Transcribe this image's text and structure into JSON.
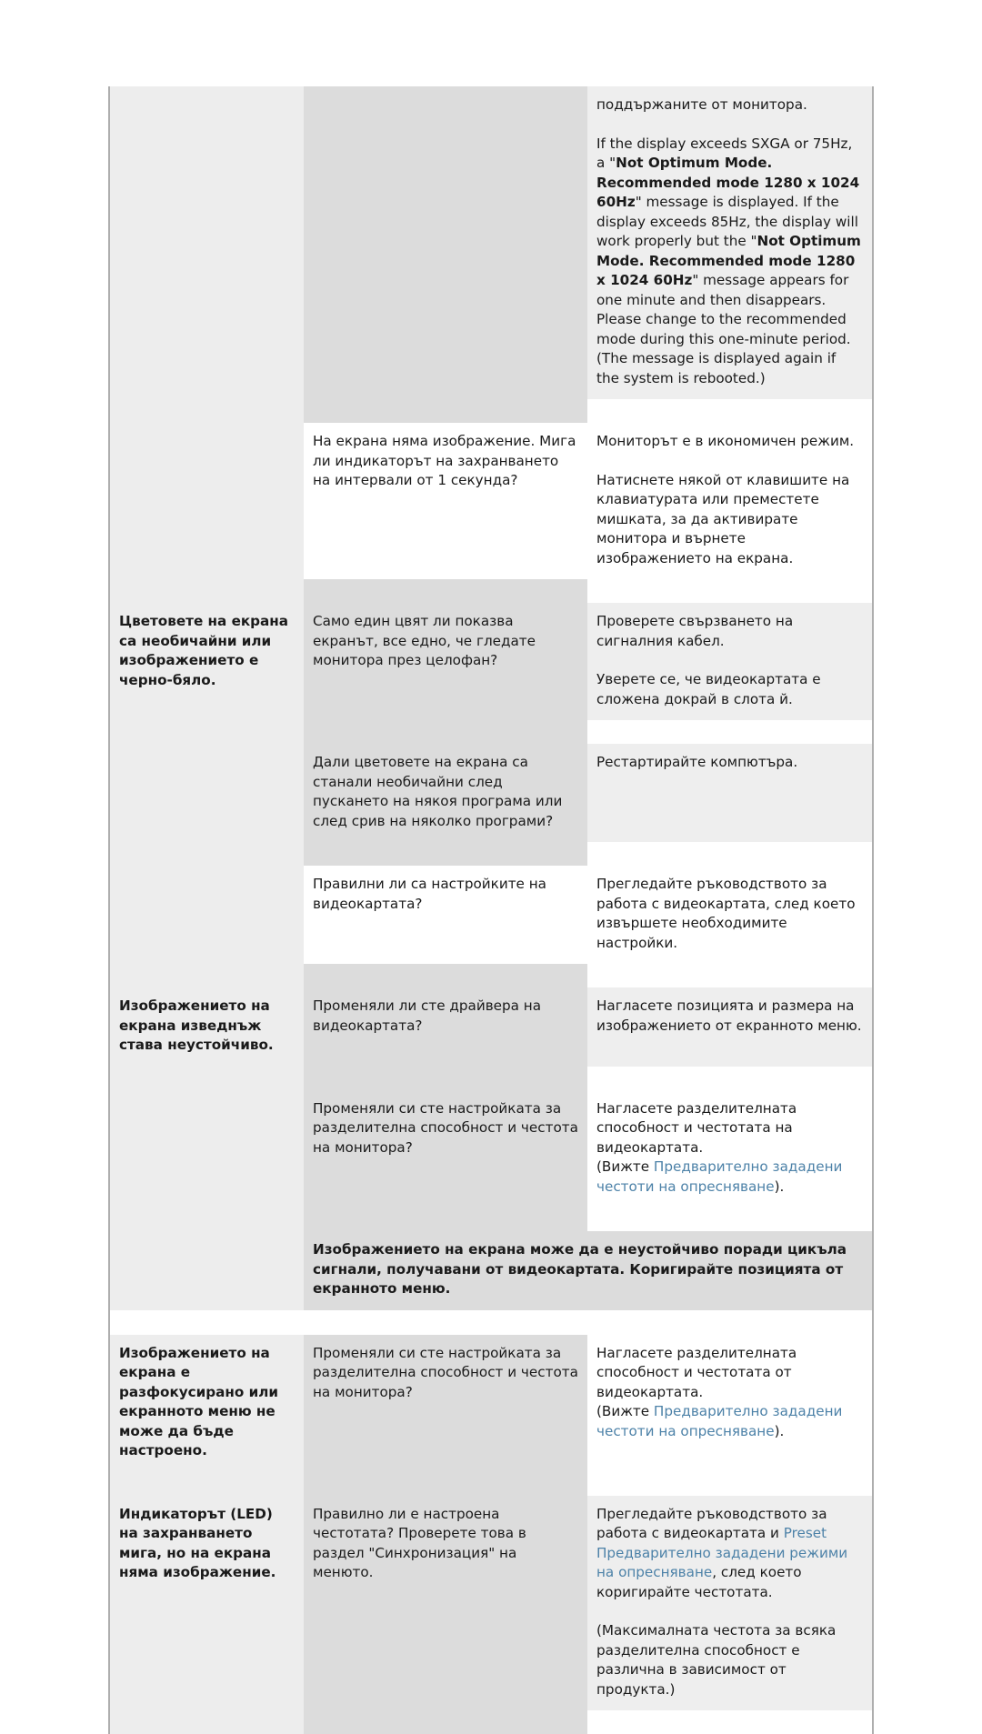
{
  "document": {
    "language": "bg",
    "kind": "monitor-troubleshooting-table",
    "link_color": "#4d82a8",
    "shade_color": "#dcdcdc",
    "category_color": "#ededed"
  },
  "rows": [
    {
      "id": "row-resolution-message",
      "category": "",
      "question": "",
      "answer_blocks": [
        {
          "type": "plain",
          "text": "поддържаните от монитора."
        },
        {
          "type": "spacer"
        },
        {
          "type": "rich",
          "segments": [
            {
              "text": "If the display exceeds SXGA or 75Hz, a \"",
              "bold": false
            },
            {
              "text": "Not Optimum Mode. Recommended mode 1280 x 1024 60Hz",
              "bold": true
            },
            {
              "text": "\" message is displayed. If the display exceeds 85Hz, the display will work properly but the \"",
              "bold": false
            },
            {
              "text": "Not Optimum Mode. Recommended mode 1280 x 1024 60Hz",
              "bold": true
            },
            {
              "text": "\" message appears for one minute and then disappears.",
              "bold": false
            }
          ]
        },
        {
          "type": "plain",
          "text": "Please change to the recommended mode during this one-minute period."
        },
        {
          "type": "plain",
          "text": "(The message is displayed again if the system is rebooted.)"
        }
      ],
      "q_shaded": true,
      "a_shaded": true,
      "cat_blank": true
    },
    {
      "id": "row-power-saving",
      "category": "",
      "question": "На екрана няма изображение. Мига ли индикаторът на захранването на интервали от 1 секунда?",
      "answer_blocks": [
        {
          "type": "plain",
          "text": "Мониторът е в икономичен режим."
        },
        {
          "type": "spacer"
        },
        {
          "type": "plain",
          "text": "Натиснете някой от клавишите на клавиатурата или преместете мишката, за да активирате монитора и върнете изображението на екрана."
        }
      ],
      "q_shaded": false,
      "a_shaded": false,
      "cat_blank": true
    },
    {
      "id": "row-colors-unusual",
      "category": "Цветовете на екрана са необичайни или изображението е черно-бяло.",
      "question": "Само един цвят ли показва екранът, все едно, че гледате монитора през целофан?",
      "answer_blocks": [
        {
          "type": "plain",
          "text": "Проверете свързването на сигналния кабел."
        },
        {
          "type": "spacer"
        },
        {
          "type": "plain",
          "text": "Уверете се, че видеокартата е сложена докрай в слота й."
        }
      ],
      "q_shaded": true,
      "a_shaded": true,
      "cat_blank": false
    },
    {
      "id": "row-colors-after-program",
      "category": "",
      "question": "Дали цветовете на екрана са станали необичайни след пускането на някоя програма или след срив на няколко програми?",
      "answer_blocks": [
        {
          "type": "plain",
          "text": "Рестартирайте компютъра."
        }
      ],
      "q_shaded": true,
      "a_shaded": true,
      "cat_blank": true
    },
    {
      "id": "row-videocard-settings",
      "category": "",
      "question": "Правилни ли са настройките на видеокартата?",
      "answer_blocks": [
        {
          "type": "plain",
          "text": "Прегледайте ръководството за работа с видеокартата, след което извършете необходимите настройки."
        }
      ],
      "q_shaded": false,
      "a_shaded": false,
      "cat_blank": true
    },
    {
      "id": "row-screen-unstable",
      "category": "Изображението на екрана изведнъж става неустойчиво.",
      "question": "Променяли ли сте драйвера на видеокартата?",
      "answer_blocks": [
        {
          "type": "plain",
          "text": "Нагласете позицията и размера на изображението от екранното меню."
        }
      ],
      "q_shaded": true,
      "a_shaded": true,
      "cat_blank": false
    },
    {
      "id": "row-resolution-changed-1",
      "category": "",
      "question": "Променяли си сте настройката за разделителна способност и честота на монитора?",
      "answer_blocks": [
        {
          "type": "plain",
          "text": "Нагласете разделителната способност и честотата на видеокартата."
        },
        {
          "type": "rich",
          "segments": [
            {
              "text": "(Вижте ",
              "bold": false
            },
            {
              "text": "Предварително зададени честоти на опресняване",
              "link": true
            },
            {
              "text": ").",
              "bold": false
            }
          ]
        }
      ],
      "q_shaded": true,
      "a_shaded": false,
      "cat_blank": true
    },
    {
      "id": "row-note-cycle-signals",
      "category": "",
      "note": "Изображението на екрана може да е неустойчиво поради цикъла сигнали, получавани от видеокартата. Коригирайте позицията от екранното меню."
    },
    {
      "id": "row-out-of-focus",
      "category": "Изображението на екрана е разфокусирано или екранното меню не може да бъде настроено.",
      "question": "Променяли си сте настройката за разделителна способност и честота на монитора?",
      "answer_blocks": [
        {
          "type": "plain",
          "text": "Нагласете разделителната способност и честотата от видеокартата."
        },
        {
          "type": "rich",
          "segments": [
            {
              "text": "(Вижте ",
              "bold": false
            },
            {
              "text": "Предварително зададени честоти на опресняване",
              "link": true
            },
            {
              "text": ").",
              "bold": false
            }
          ]
        }
      ],
      "q_shaded": true,
      "a_shaded": false,
      "cat_blank": false
    },
    {
      "id": "row-led-blinking",
      "category": "Индикаторът (LED) на захранването мига, но на екрана няма изображение.",
      "question": "Правилно ли е настроена честотата? Проверете това в раздел \"Синхронизация\" на менюто.",
      "answer_blocks": [
        {
          "type": "rich",
          "segments": [
            {
              "text": "Прегледайте ръководството за работа с видеокартата и ",
              "bold": false
            },
            {
              "text": "Preset Предварително зададени режими на опресняване",
              "link": true
            },
            {
              "text": ", след което коригирайте честотата.",
              "bold": false
            }
          ]
        },
        {
          "type": "spacer"
        },
        {
          "type": "plain",
          "text": "(Максималната честота за всяка разделителна способност е различна в зависимост от продукта.)"
        }
      ],
      "q_shaded": true,
      "a_shaded": true,
      "cat_blank": false
    }
  ]
}
